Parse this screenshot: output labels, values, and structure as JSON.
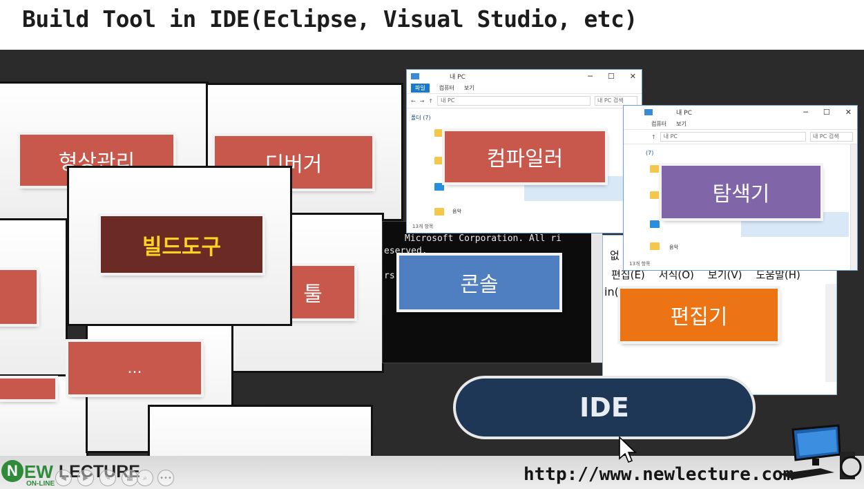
{
  "slide": {
    "title": "Build Tool in IDE(Eclipse, Visual Studio, etc)"
  },
  "tools": {
    "config_mgmt": "형상관리",
    "debugger": "디버거",
    "build_tool": "빌드도구",
    "tools": "툴",
    "more": "...",
    "compiler": "컴파일러",
    "explorer": "탐색기",
    "console": "콘솔",
    "editor": "편집기"
  },
  "ide_label": "IDE",
  "explorer_window_1": {
    "title": "내 PC",
    "ribbon": [
      "파일",
      "컴퓨터",
      "보기"
    ],
    "address": "내 PC",
    "search_placeholder": "내 PC 검색",
    "section": "폴더 (7)",
    "item_music": "음악",
    "status": "13개 항목"
  },
  "explorer_window_2": {
    "title": "내 PC",
    "ribbon": [
      "컴퓨터",
      "보기"
    ],
    "address": "내 PC",
    "search_placeholder": "내 PC 검색",
    "section": "(7)",
    "item_music": "음악",
    "status": "13개 항목"
  },
  "console_window": {
    "lines": [
      "Microsoft Corporation. All ri",
      "eserved.",
      "rs"
    ]
  },
  "notepad_window": {
    "title_fragment": "없",
    "menu": [
      "편집(E)",
      "서식(O)",
      "보기(V)",
      "도움말(H)"
    ],
    "text": "in("
  },
  "footer": {
    "logo_n": "N",
    "logo_ew": "EW",
    "logo_lecture": "LECTURE",
    "logo_sub": "ON-LINE",
    "url": "http://www.newlecture.com"
  },
  "colors": {
    "tile_red": "#c8584c",
    "build_tile": "#6b2a24",
    "build_text": "#ffd21f",
    "compiler_tile": "#c8584c",
    "explorer_tile": "#8066a8",
    "console_tile": "#4f7fc0",
    "editor_tile": "#ec7414",
    "ide_pill": "#1f3757",
    "brand_green": "#2f8a3a"
  }
}
